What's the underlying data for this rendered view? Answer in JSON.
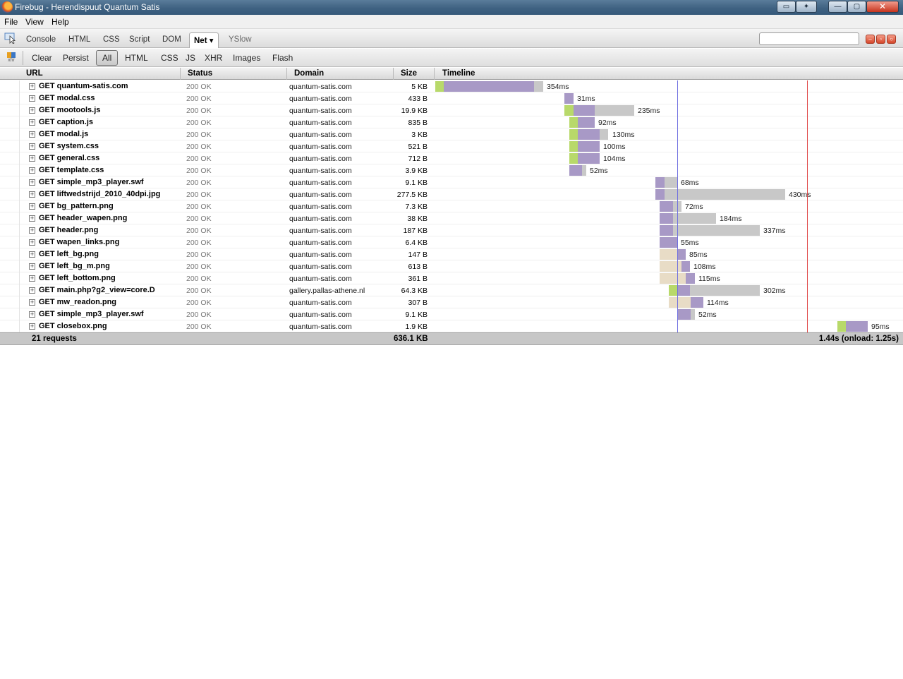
{
  "window": {
    "title": "Firebug - Herendispuut Quantum Satis"
  },
  "menu": {
    "file": "File",
    "view": "View",
    "help": "Help"
  },
  "tabs": {
    "console": "Console",
    "html": "HTML",
    "css": "CSS",
    "script": "Script",
    "dom": "DOM",
    "net": "Net",
    "yslow": "YSlow"
  },
  "search": {
    "value": ""
  },
  "netbar": {
    "clear": "Clear",
    "persist": "Persist",
    "all": "All",
    "html": "HTML",
    "css": "CSS",
    "js": "JS",
    "xhr": "XHR",
    "images": "Images",
    "flash": "Flash"
  },
  "columns": {
    "url": "URL",
    "status": "Status",
    "domain": "Domain",
    "size": "Size",
    "timeline": "Timeline"
  },
  "colors": {
    "dns": "#b8d96a",
    "connect": "#e8dcc6",
    "wait": "#a899c6",
    "receive": "#c8c8c8",
    "dom_loaded": "#6f6fe0",
    "onload": "#e04848"
  },
  "requests": [
    {
      "url": "GET quantum-satis.com",
      "status": "200 OK",
      "domain": "quantum-satis.com",
      "size": "5 KB",
      "time": "354ms"
    },
    {
      "url": "GET modal.css",
      "status": "200 OK",
      "domain": "quantum-satis.com",
      "size": "433 B",
      "time": "31ms"
    },
    {
      "url": "GET mootools.js",
      "status": "200 OK",
      "domain": "quantum-satis.com",
      "size": "19.9 KB",
      "time": "235ms"
    },
    {
      "url": "GET caption.js",
      "status": "200 OK",
      "domain": "quantum-satis.com",
      "size": "835 B",
      "time": "92ms"
    },
    {
      "url": "GET modal.js",
      "status": "200 OK",
      "domain": "quantum-satis.com",
      "size": "3 KB",
      "time": "130ms"
    },
    {
      "url": "GET system.css",
      "status": "200 OK",
      "domain": "quantum-satis.com",
      "size": "521 B",
      "time": "100ms"
    },
    {
      "url": "GET general.css",
      "status": "200 OK",
      "domain": "quantum-satis.com",
      "size": "712 B",
      "time": "104ms"
    },
    {
      "url": "GET template.css",
      "status": "200 OK",
      "domain": "quantum-satis.com",
      "size": "3.9 KB",
      "time": "52ms"
    },
    {
      "url": "GET simple_mp3_player.swf",
      "status": "200 OK",
      "domain": "quantum-satis.com",
      "size": "9.1 KB",
      "time": "68ms"
    },
    {
      "url": "GET liftwedstrijd_2010_40dpi.jpg",
      "status": "200 OK",
      "domain": "quantum-satis.com",
      "size": "277.5 KB",
      "time": "430ms"
    },
    {
      "url": "GET bg_pattern.png",
      "status": "200 OK",
      "domain": "quantum-satis.com",
      "size": "7.3 KB",
      "time": "72ms"
    },
    {
      "url": "GET header_wapen.png",
      "status": "200 OK",
      "domain": "quantum-satis.com",
      "size": "38 KB",
      "time": "184ms"
    },
    {
      "url": "GET header.png",
      "status": "200 OK",
      "domain": "quantum-satis.com",
      "size": "187 KB",
      "time": "337ms"
    },
    {
      "url": "GET wapen_links.png",
      "status": "200 OK",
      "domain": "quantum-satis.com",
      "size": "6.4 KB",
      "time": "55ms"
    },
    {
      "url": "GET left_bg.png",
      "status": "200 OK",
      "domain": "quantum-satis.com",
      "size": "147 B",
      "time": "85ms"
    },
    {
      "url": "GET left_bg_m.png",
      "status": "200 OK",
      "domain": "quantum-satis.com",
      "size": "613 B",
      "time": "108ms"
    },
    {
      "url": "GET left_bottom.png",
      "status": "200 OK",
      "domain": "quantum-satis.com",
      "size": "361 B",
      "time": "115ms"
    },
    {
      "url": "GET main.php?g2_view=core.D",
      "status": "200 OK",
      "domain": "gallery.pallas-athene.nl",
      "size": "64.3 KB",
      "time": "302ms"
    },
    {
      "url": "GET mw_readon.png",
      "status": "200 OK",
      "domain": "quantum-satis.com",
      "size": "307 B",
      "time": "114ms"
    },
    {
      "url": "GET simple_mp3_player.swf",
      "status": "200 OK",
      "domain": "quantum-satis.com",
      "size": "9.1 KB",
      "time": "52ms"
    },
    {
      "url": "GET closebox.png",
      "status": "200 OK",
      "domain": "quantum-satis.com",
      "size": "1.9 KB",
      "time": "95ms"
    }
  ],
  "footer": {
    "count": "21 requests",
    "total_size": "636.1 KB",
    "total_time": "1.44s (onload: 1.25s)"
  }
}
